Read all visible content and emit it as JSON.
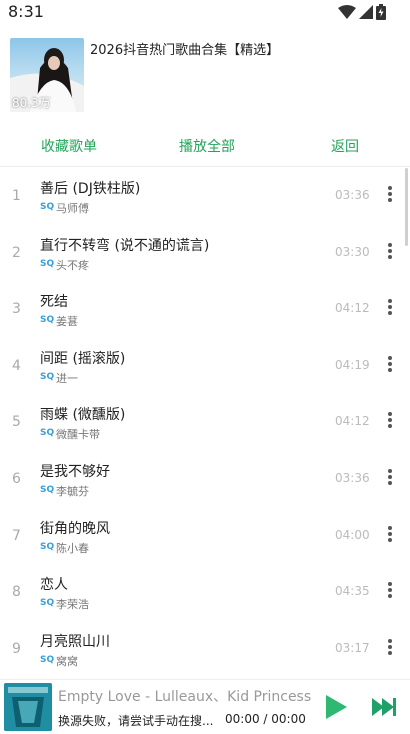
{
  "status_bar": {
    "time": "8:31"
  },
  "playlist": {
    "title": "2026抖音热门歌曲合集【精选】",
    "play_count": "80.3万"
  },
  "actions": {
    "collect": "收藏歌单",
    "play_all": "播放全部",
    "back": "返回"
  },
  "quality_label": "SQ",
  "songs": [
    {
      "index": "1",
      "title": "善后 (DJ铁柱版)",
      "artist": "马师傅",
      "duration": "03:36"
    },
    {
      "index": "2",
      "title": "直行不转弯 (说不通的谎言)",
      "artist": "头不疼",
      "duration": "03:30"
    },
    {
      "index": "3",
      "title": "死结",
      "artist": "姜葚",
      "duration": "04:12"
    },
    {
      "index": "4",
      "title": "间距 (摇滚版)",
      "artist": "进一",
      "duration": "04:19"
    },
    {
      "index": "5",
      "title": "雨蝶 (微醺版)",
      "artist": "微醺卡带",
      "duration": "04:12"
    },
    {
      "index": "6",
      "title": "是我不够好",
      "artist": "李毓芬",
      "duration": "03:36"
    },
    {
      "index": "7",
      "title": "街角的晚风",
      "artist": "陈小春",
      "duration": "04:00"
    },
    {
      "index": "8",
      "title": "恋人",
      "artist": "李荣浩",
      "duration": "04:35"
    },
    {
      "index": "9",
      "title": "月亮照山川",
      "artist": "窝窝",
      "duration": "03:17"
    }
  ],
  "player": {
    "title": "Empty Love - Lulleaux、Kid Princess",
    "status": "换源失败，请尝试手动在搜...",
    "time": "00:00 / 00:00"
  },
  "colors": {
    "accent": "#22a55a",
    "play_button": "#2eb872",
    "next_button": "#1fa06a",
    "sq_badge": "#3aa0d8"
  },
  "icons": {
    "wifi": "wifi-icon",
    "signal": "signal-icon",
    "battery": "battery-icon",
    "more": "more-vertical-icon",
    "play": "play-icon",
    "next": "skip-next-icon"
  }
}
